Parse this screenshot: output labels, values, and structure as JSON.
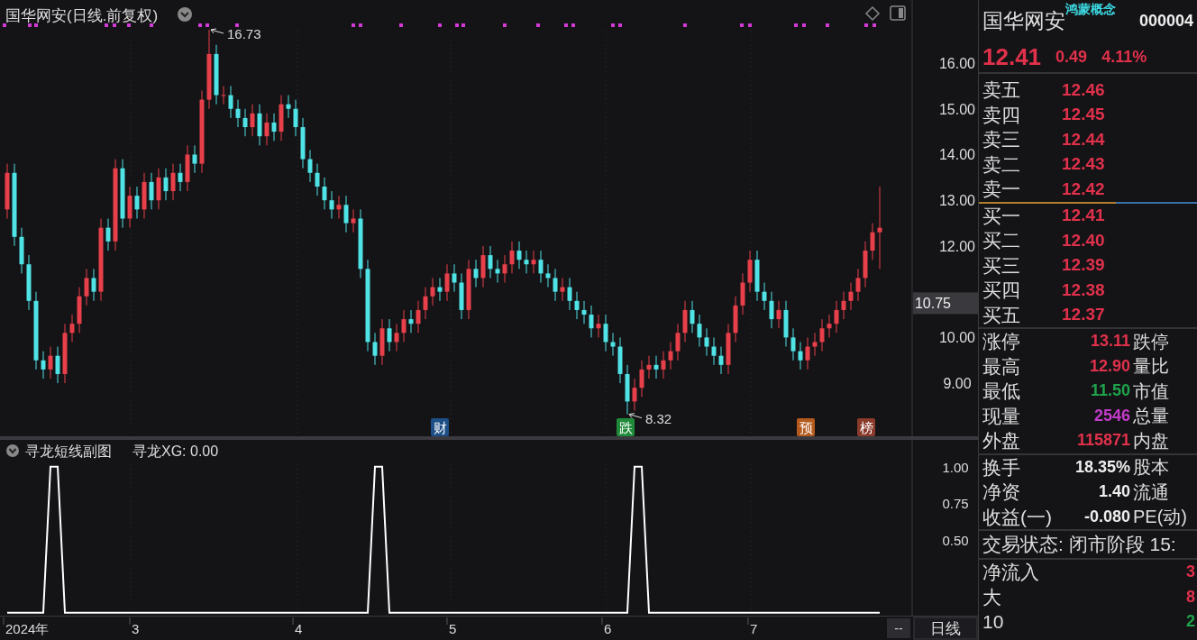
{
  "title": "国华网安(日线.前复权)",
  "price_chart": {
    "cursor_price": "10.75",
    "chart_data": {
      "type": "candlestick",
      "ylim": [
        7.8,
        17.38
      ],
      "yticks": [
        {
          "value": 16,
          "label": "16.00"
        },
        {
          "value": 15,
          "label": "15.00"
        },
        {
          "value": 14,
          "label": "14.00"
        },
        {
          "value": 13,
          "label": "13.00"
        },
        {
          "value": 12,
          "label": "12.00"
        },
        {
          "value": 10,
          "label": "10.00"
        },
        {
          "value": 9,
          "label": "9.00"
        }
      ],
      "ohlc": [
        [
          12.8,
          13.8,
          12.6,
          13.6
        ],
        [
          13.6,
          13.8,
          12.0,
          12.2
        ],
        [
          12.2,
          12.4,
          11.4,
          11.6
        ],
        [
          11.6,
          11.8,
          10.6,
          10.8
        ],
        [
          10.8,
          11.0,
          9.3,
          9.5
        ],
        [
          9.5,
          9.7,
          9.1,
          9.3
        ],
        [
          9.3,
          9.8,
          9.1,
          9.6
        ],
        [
          9.6,
          9.8,
          9.0,
          9.2
        ],
        [
          9.2,
          10.3,
          9.0,
          10.1
        ],
        [
          10.1,
          10.5,
          9.9,
          10.3
        ],
        [
          10.3,
          11.1,
          10.1,
          10.9
        ],
        [
          10.9,
          11.5,
          10.7,
          11.3
        ],
        [
          11.3,
          11.5,
          10.8,
          11.0
        ],
        [
          11.0,
          12.6,
          10.8,
          12.4
        ],
        [
          12.4,
          12.6,
          11.9,
          12.1
        ],
        [
          12.1,
          13.9,
          11.9,
          13.7
        ],
        [
          13.7,
          13.9,
          12.4,
          12.6
        ],
        [
          12.6,
          13.3,
          12.4,
          13.1
        ],
        [
          13.1,
          13.3,
          12.6,
          12.8
        ],
        [
          12.8,
          13.6,
          12.6,
          13.4
        ],
        [
          13.4,
          13.6,
          12.8,
          13.0
        ],
        [
          13.0,
          13.7,
          12.8,
          13.5
        ],
        [
          13.5,
          13.7,
          13.0,
          13.2
        ],
        [
          13.2,
          13.8,
          13.0,
          13.6
        ],
        [
          13.6,
          13.8,
          13.2,
          13.4
        ],
        [
          13.4,
          14.2,
          13.2,
          14.0
        ],
        [
          14.0,
          14.2,
          13.6,
          13.8
        ],
        [
          13.8,
          15.4,
          13.6,
          15.2
        ],
        [
          15.2,
          16.73,
          15.0,
          16.2
        ],
        [
          16.2,
          16.4,
          15.1,
          15.3
        ],
        [
          15.3,
          15.5,
          15.1,
          15.3
        ],
        [
          15.3,
          15.5,
          14.8,
          15.0
        ],
        [
          15.0,
          15.2,
          14.6,
          14.8
        ],
        [
          14.8,
          15.0,
          14.4,
          14.6
        ],
        [
          14.6,
          15.1,
          14.4,
          14.9
        ],
        [
          14.9,
          15.1,
          14.2,
          14.4
        ],
        [
          14.4,
          14.9,
          14.2,
          14.7
        ],
        [
          14.7,
          14.9,
          14.3,
          14.5
        ],
        [
          14.5,
          15.3,
          14.3,
          15.1
        ],
        [
          15.1,
          15.3,
          14.8,
          15.0
        ],
        [
          15.0,
          15.2,
          14.4,
          14.6
        ],
        [
          14.6,
          14.8,
          13.7,
          13.9
        ],
        [
          13.9,
          14.1,
          13.4,
          13.6
        ],
        [
          13.6,
          13.8,
          13.1,
          13.3
        ],
        [
          13.3,
          13.5,
          12.8,
          13.0
        ],
        [
          13.0,
          13.2,
          12.6,
          12.8
        ],
        [
          12.8,
          13.1,
          12.6,
          12.9
        ],
        [
          12.9,
          13.1,
          12.3,
          12.5
        ],
        [
          12.5,
          12.8,
          12.3,
          12.6
        ],
        [
          12.6,
          12.8,
          11.3,
          11.5
        ],
        [
          11.5,
          11.7,
          9.7,
          9.9
        ],
        [
          9.9,
          10.1,
          9.4,
          9.6
        ],
        [
          9.6,
          10.4,
          9.4,
          10.2
        ],
        [
          10.2,
          10.4,
          9.7,
          9.9
        ],
        [
          9.9,
          10.3,
          9.7,
          10.1
        ],
        [
          10.1,
          10.6,
          9.9,
          10.4
        ],
        [
          10.4,
          10.6,
          10.1,
          10.3
        ],
        [
          10.3,
          10.8,
          10.1,
          10.6
        ],
        [
          10.6,
          11.1,
          10.4,
          10.9
        ],
        [
          10.9,
          11.3,
          10.7,
          11.1
        ],
        [
          11.1,
          11.3,
          10.8,
          11.0
        ],
        [
          11.0,
          11.6,
          10.8,
          11.4
        ],
        [
          11.4,
          11.6,
          11.0,
          11.2
        ],
        [
          11.2,
          11.4,
          10.4,
          10.6
        ],
        [
          10.6,
          11.7,
          10.4,
          11.5
        ],
        [
          11.5,
          11.7,
          11.1,
          11.3
        ],
        [
          11.3,
          12.0,
          11.1,
          11.8
        ],
        [
          11.8,
          12.0,
          11.3,
          11.5
        ],
        [
          11.5,
          11.7,
          11.2,
          11.4
        ],
        [
          11.4,
          11.8,
          11.2,
          11.6
        ],
        [
          11.6,
          12.1,
          11.4,
          11.9
        ],
        [
          11.9,
          12.1,
          11.5,
          11.7
        ],
        [
          11.7,
          11.9,
          11.4,
          11.6
        ],
        [
          11.6,
          11.9,
          11.4,
          11.7
        ],
        [
          11.7,
          11.9,
          11.2,
          11.4
        ],
        [
          11.4,
          11.6,
          11.1,
          11.3
        ],
        [
          11.3,
          11.5,
          10.8,
          11.0
        ],
        [
          11.0,
          11.3,
          10.8,
          11.1
        ],
        [
          11.1,
          11.3,
          10.6,
          10.8
        ],
        [
          10.8,
          11.0,
          10.4,
          10.6
        ],
        [
          10.6,
          10.8,
          10.3,
          10.5
        ],
        [
          10.5,
          10.7,
          10.0,
          10.2
        ],
        [
          10.2,
          10.5,
          10.0,
          10.3
        ],
        [
          10.3,
          10.5,
          9.7,
          9.9
        ],
        [
          9.9,
          10.1,
          9.6,
          9.8
        ],
        [
          9.8,
          10.0,
          9.0,
          9.2
        ],
        [
          9.2,
          9.4,
          8.32,
          8.6
        ],
        [
          8.6,
          9.1,
          8.4,
          8.9
        ],
        [
          8.9,
          9.5,
          8.7,
          9.3
        ],
        [
          9.3,
          9.6,
          9.1,
          9.4
        ],
        [
          9.4,
          9.6,
          9.1,
          9.3
        ],
        [
          9.3,
          9.7,
          9.1,
          9.5
        ],
        [
          9.5,
          9.9,
          9.3,
          9.7
        ],
        [
          9.7,
          10.3,
          9.5,
          10.1
        ],
        [
          10.1,
          10.8,
          9.9,
          10.6
        ],
        [
          10.6,
          10.8,
          10.1,
          10.3
        ],
        [
          10.3,
          10.5,
          9.8,
          10.0
        ],
        [
          10.0,
          10.2,
          9.6,
          9.8
        ],
        [
          9.8,
          10.0,
          9.4,
          9.6
        ],
        [
          9.6,
          9.8,
          9.2,
          9.4
        ],
        [
          9.4,
          10.3,
          9.2,
          10.1
        ],
        [
          10.1,
          10.9,
          9.9,
          10.7
        ],
        [
          10.7,
          11.4,
          10.5,
          11.2
        ],
        [
          11.2,
          11.9,
          11.0,
          11.7
        ],
        [
          11.7,
          11.9,
          10.8,
          11.0
        ],
        [
          11.0,
          11.2,
          10.6,
          10.8
        ],
        [
          10.8,
          11.0,
          10.2,
          10.4
        ],
        [
          10.4,
          10.8,
          10.2,
          10.6
        ],
        [
          10.6,
          10.8,
          9.8,
          10.0
        ],
        [
          10.0,
          10.2,
          9.5,
          9.7
        ],
        [
          9.7,
          9.9,
          9.3,
          9.5
        ],
        [
          9.5,
          10.0,
          9.3,
          9.8
        ],
        [
          9.8,
          10.1,
          9.6,
          9.9
        ],
        [
          9.9,
          10.4,
          9.7,
          10.2
        ],
        [
          10.2,
          10.5,
          10.0,
          10.3
        ],
        [
          10.3,
          10.8,
          10.1,
          10.6
        ],
        [
          10.6,
          11.0,
          10.4,
          10.8
        ],
        [
          10.8,
          11.2,
          10.6,
          11.0
        ],
        [
          11.0,
          11.5,
          10.8,
          11.3
        ],
        [
          11.3,
          12.1,
          11.1,
          11.9
        ],
        [
          11.9,
          12.5,
          11.7,
          12.3
        ],
        [
          12.3,
          13.3,
          11.5,
          12.4
        ]
      ]
    }
  },
  "extremes": [
    {
      "label": "16.73"
    },
    {
      "label": "8.32"
    }
  ],
  "events": [
    {
      "label": "财",
      "color": "#1d4f86"
    },
    {
      "label": "跌",
      "color": "#1f8a3a"
    },
    {
      "label": "预",
      "color": "#b45a1c"
    },
    {
      "label": "榜",
      "color": "#8a3a2a"
    }
  ],
  "indicator": {
    "title": "寻龙短线副图",
    "reading": "寻龙XG: 0.00",
    "chart_data": {
      "type": "line",
      "ylim": [
        -0.02,
        1.19
      ],
      "yticks": [
        {
          "value": 0.5,
          "label": "0.50"
        },
        {
          "value": 0.75,
          "label": "0.75"
        },
        {
          "value": 1,
          "label": "1.00"
        }
      ],
      "series": [
        {
          "color": "#ffffff",
          "values": [
            0,
            0,
            0,
            0,
            0,
            0,
            1,
            1,
            0,
            0,
            0,
            0,
            0,
            0,
            0,
            0,
            0,
            0,
            0,
            0,
            0,
            0,
            0,
            0,
            0,
            0,
            0,
            0,
            0,
            0,
            0,
            0,
            0,
            0,
            0,
            0,
            0,
            0,
            0,
            0,
            0,
            0,
            0,
            0,
            0,
            0,
            0,
            0,
            0,
            0,
            0,
            1,
            1,
            0,
            0,
            0,
            0,
            0,
            0,
            0,
            0,
            0,
            0,
            0,
            0,
            0,
            0,
            0,
            0,
            0,
            0,
            0,
            0,
            0,
            0,
            0,
            0,
            0,
            0,
            0,
            0,
            0,
            0,
            0,
            0,
            0,
            0,
            1,
            1,
            0,
            0,
            0,
            0,
            0,
            0,
            0,
            0,
            0,
            0,
            0,
            0,
            0,
            0,
            0,
            0,
            0,
            0,
            0,
            0,
            0,
            0,
            0,
            0,
            0,
            0,
            0,
            0,
            0,
            0,
            0,
            0,
            0
          ]
        }
      ]
    }
  },
  "time_axis": {
    "labels": [
      "2024年",
      "3",
      "4",
      "5",
      "6",
      "7"
    ],
    "scroll": "--",
    "period": "日线"
  },
  "quote": {
    "name": "国华网安",
    "concept": "鸿蒙概念",
    "code": "000004",
    "price": "12.41",
    "change": "0.49",
    "change_pct": "4.11%",
    "asks": [
      {
        "label": "卖五",
        "price": "12.46"
      },
      {
        "label": "卖四",
        "price": "12.45"
      },
      {
        "label": "卖三",
        "price": "12.44"
      },
      {
        "label": "卖二",
        "price": "12.43"
      },
      {
        "label": "卖一",
        "price": "12.42"
      }
    ],
    "bids": [
      {
        "label": "买一",
        "price": "12.41"
      },
      {
        "label": "买二",
        "price": "12.40"
      },
      {
        "label": "买三",
        "price": "12.39"
      },
      {
        "label": "买四",
        "price": "12.38"
      },
      {
        "label": "买五",
        "price": "12.37"
      }
    ],
    "stats": [
      {
        "label": "涨停",
        "value": "13.11",
        "color": "#e0314b",
        "label2": "跌停"
      },
      {
        "label": "最高",
        "value": "12.90",
        "color": "#e0314b",
        "label2": "量比"
      },
      {
        "label": "最低",
        "value": "11.50",
        "color": "#1fa34a",
        "label2": "市值"
      },
      {
        "label": "现量",
        "value": "2546",
        "color": "#c23cc8",
        "label2": "总量"
      },
      {
        "label": "外盘",
        "value": "115871",
        "color": "#e0314b",
        "label2": "内盘"
      }
    ],
    "fundamentals": [
      {
        "label": "换手",
        "value": "18.35%",
        "label2": "股本"
      },
      {
        "label": "净资",
        "value": "1.40",
        "label2": "流通"
      },
      {
        "label": "收益(一)",
        "value": "-0.080",
        "label2": "PE(动)"
      }
    ],
    "status": "交易状态: 闭市阶段 15:",
    "flows": [
      {
        "label": "净流入",
        "value": "3",
        "color": "#e0314b"
      },
      {
        "label": "大",
        "value": "8",
        "color": "#e0314b"
      },
      {
        "label": "10",
        "value": "2",
        "color": "#1fa34a"
      }
    ]
  }
}
